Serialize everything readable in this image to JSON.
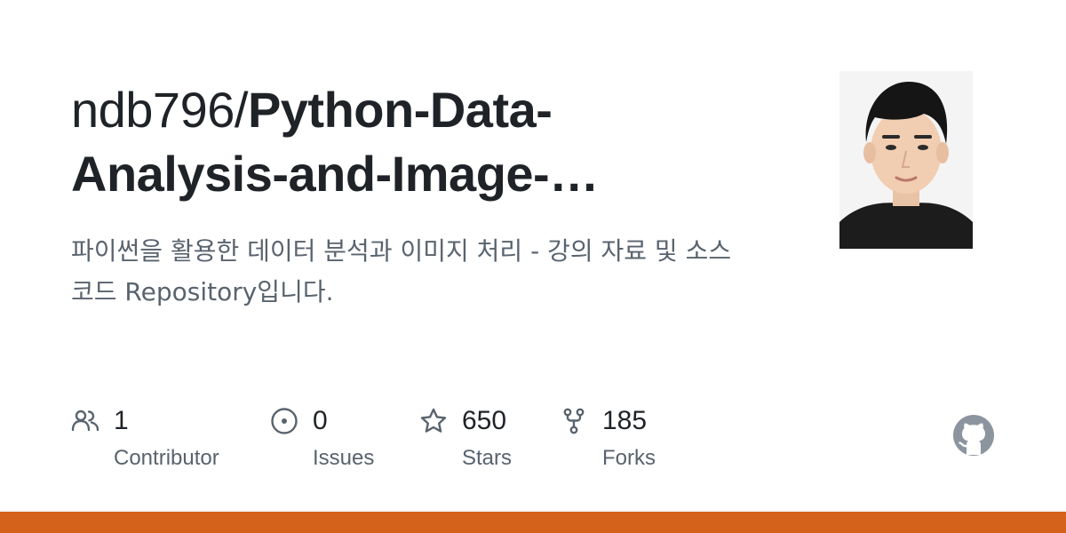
{
  "repo": {
    "owner_prefix": "ndb796/",
    "name_display": "Python-Data-Analysis-and-Image-…",
    "description": "파이썬을 활용한 데이터 분석과 이미지 처리 - 강의 자료 및 소스코드 Repository입니다."
  },
  "avatar": {
    "icon": "user-avatar-photo"
  },
  "stats": [
    {
      "icon": "people-icon",
      "value": "1",
      "label": "Contributor"
    },
    {
      "icon": "issue-opened-icon",
      "value": "0",
      "label": "Issues"
    },
    {
      "icon": "star-icon",
      "value": "650",
      "label": "Stars"
    },
    {
      "icon": "repo-forked-icon",
      "value": "185",
      "label": "Forks"
    }
  ],
  "brand": {
    "logo": "github-mark-icon"
  },
  "colors": {
    "accent_bar": "#d4621a",
    "text_primary": "#1f2328",
    "text_secondary": "#59636e",
    "icon": "#59636e",
    "logo": "#8c959f"
  }
}
